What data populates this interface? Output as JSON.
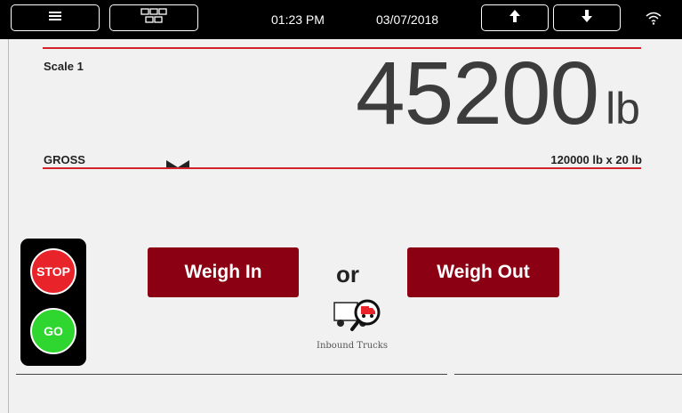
{
  "topbar": {
    "time": "01:23 PM",
    "date": "03/07/2018"
  },
  "scale": {
    "name": "Scale 1",
    "weight": "45200",
    "unit": "lb",
    "mode": "GROSS",
    "capacity": "120000 lb x 20 lb"
  },
  "traffic_light": {
    "stop": "STOP",
    "go": "GO",
    "stop_color": "#e8232a",
    "go_color": "#2fd62f"
  },
  "actions": {
    "weigh_in": "Weigh In",
    "or": "or",
    "weigh_out": "Weigh Out",
    "inbound_trucks": "Inbound Trucks"
  },
  "colors": {
    "accent_red": "#d2232a",
    "button_red": "#8b0012"
  }
}
